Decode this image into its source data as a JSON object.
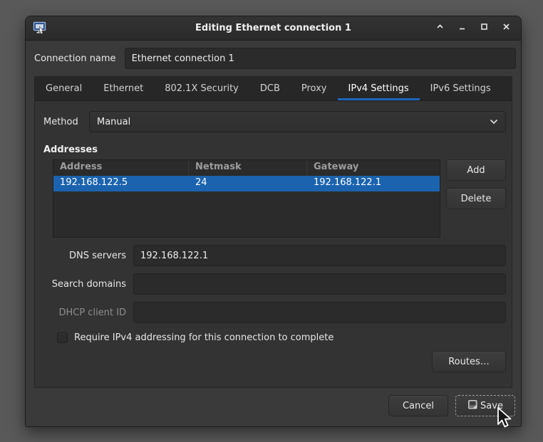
{
  "window": {
    "title": "Editing Ethernet connection 1"
  },
  "connection_name": {
    "label": "Connection name",
    "value": "Ethernet connection 1"
  },
  "tabs": {
    "items": [
      "General",
      "Ethernet",
      "802.1X Security",
      "DCB",
      "Proxy",
      "IPv4 Settings",
      "IPv6 Settings"
    ],
    "active": "IPv4 Settings"
  },
  "ipv4_settings": {
    "method": {
      "label": "Method",
      "value": "Manual"
    },
    "addresses": {
      "section_label": "Addresses",
      "headers": [
        "Address",
        "Netmask",
        "Gateway"
      ],
      "rows": [
        {
          "address": "192.168.122.5",
          "netmask": "24",
          "gateway": "192.168.122.1"
        }
      ],
      "selected_row_index": 0,
      "add_button": "Add",
      "delete_button": "Delete"
    },
    "dns_servers": {
      "label": "DNS servers",
      "value": "192.168.122.1"
    },
    "search_domains": {
      "label": "Search domains",
      "value": ""
    },
    "dhcp_client_id": {
      "label": "DHCP client ID",
      "value": "",
      "disabled": true
    },
    "require_checkbox": {
      "label": "Require IPv4 addressing for this connection to complete",
      "checked": false
    },
    "routes_button": "Routes…"
  },
  "footer": {
    "cancel_button": "Cancel",
    "save_button": "Save"
  },
  "icons": {
    "app": "network-connection-editor-icon",
    "shade": "chevron-up-icon",
    "minimize": "minimize-icon",
    "maximize": "maximize-icon",
    "close": "close-icon",
    "method_dropdown": "chevron-down-icon",
    "save": "save-floppy-icon",
    "pointer": "arrow-cursor-icon"
  },
  "colors": {
    "selection_blue": "#1b63ae",
    "tab_underline_blue": "#1e65bd",
    "window_background": "#3a3a3a",
    "titlebar_background": "#2d2d2d",
    "desktop_background": "#595959"
  }
}
